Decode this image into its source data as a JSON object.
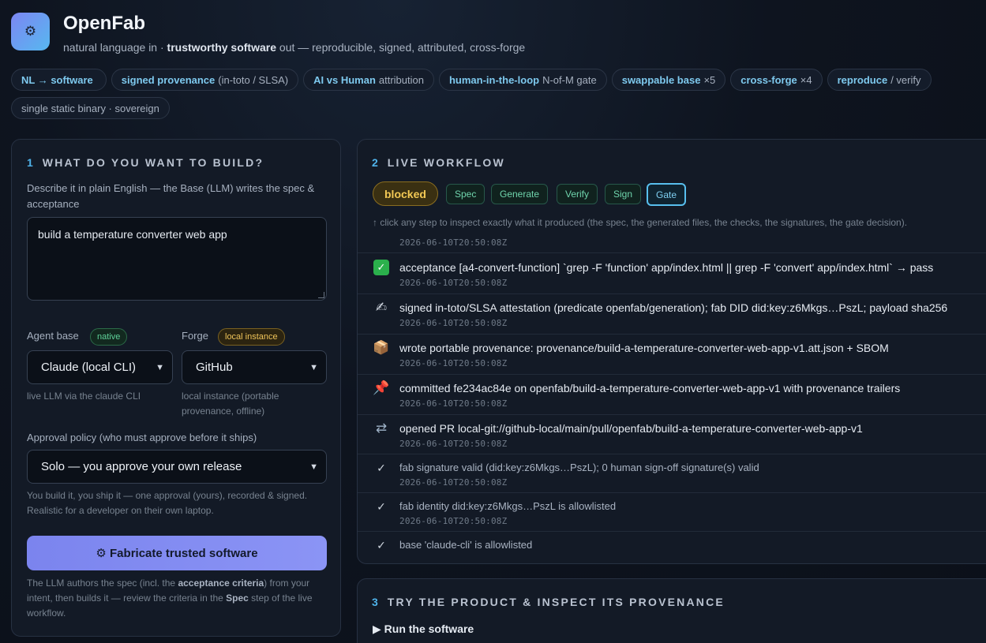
{
  "app": {
    "logo_icon": "gear-icon",
    "title": "OpenFab",
    "tagline_pre": "natural language in · ",
    "tagline_bold": "trustworthy software",
    "tagline_post": " out — reproducible, signed, attributed, cross-forge"
  },
  "features": [
    {
      "strong": "NL → software",
      "rest": ""
    },
    {
      "strong": "signed provenance",
      "rest": "(in-toto / SLSA)"
    },
    {
      "strong": "AI vs Human",
      "rest": "attribution"
    },
    {
      "strong": "human-in-the-loop",
      "rest": "N-of-M gate"
    },
    {
      "strong": "swappable base",
      "rest": "×5"
    },
    {
      "strong": "cross-forge",
      "rest": "×4"
    },
    {
      "strong": "reproduce",
      "rest": "/ verify"
    },
    {
      "strong": "",
      "rest": "single static binary · sovereign"
    }
  ],
  "build": {
    "num": "1",
    "title": "WHAT DO YOU WANT TO BUILD?",
    "describe_label": "Describe it in plain English — the Base (LLM) writes the spec & acceptance",
    "intent_value": "build a temperature converter web app",
    "agent_label": "Agent base",
    "agent_tag": "native",
    "agent_value": "Claude (local CLI)",
    "agent_hint": "live LLM via the claude CLI",
    "forge_label": "Forge",
    "forge_tag": "local instance",
    "forge_value": "GitHub",
    "forge_hint": "local instance (portable provenance, offline)",
    "policy_label": "Approval policy (who must approve before it ships)",
    "policy_value": "Solo — you approve your own release",
    "policy_hint": "You build it, you ship it — one approval (yours), recorded & signed. Realistic for a developer on their own laptop.",
    "cta_label": "⚙ Fabricate trusted software",
    "cta_hint_1": "The LLM authors the spec (incl. the ",
    "cta_hint_b1": "acceptance criteria",
    "cta_hint_2": ") from your intent, then builds it — review the criteria in the ",
    "cta_hint_b2": "Spec",
    "cta_hint_3": " step of the live workflow."
  },
  "workflow": {
    "num": "2",
    "title": "LIVE WORKFLOW",
    "status": "blocked",
    "status_color": "#f3c955",
    "steps": [
      "Spec",
      "Generate",
      "Verify",
      "Sign",
      "Gate"
    ],
    "active_step": "Gate",
    "hint": "↑ click any step to inspect exactly what it produced (the spec, the generated files, the checks, the signatures, the gate decision).",
    "events": [
      {
        "icon": "",
        "icon_name": "",
        "msg": "",
        "ts": "2026-06-10T20:50:08Z",
        "minor": false
      },
      {
        "icon": "✓",
        "icon_name": "check-box-icon",
        "msg": "acceptance [a4-convert-function] `grep -F 'function' app/index.html || grep -F 'convert' app/index.html` → pass",
        "ts": "2026-06-10T20:50:08Z",
        "minor": false
      },
      {
        "icon": "✍",
        "icon_name": "signing-pen-icon",
        "msg": "signed in-toto/SLSA attestation (predicate openfab/generation); fab DID did:key:z6Mkgs…PszL; payload sha256",
        "ts": "2026-06-10T20:50:08Z",
        "minor": false
      },
      {
        "icon": "📦",
        "icon_name": "package-icon",
        "msg": "wrote portable provenance: provenance/build-a-temperature-converter-web-app-v1.att.json + SBOM",
        "ts": "2026-06-10T20:50:08Z",
        "minor": false
      },
      {
        "icon": "📌",
        "icon_name": "pushpin-icon",
        "msg": "committed fe234ac84e on openfab/build-a-temperature-converter-web-app-v1 with provenance trailers",
        "ts": "2026-06-10T20:50:08Z",
        "minor": false
      },
      {
        "icon": "⇄",
        "icon_name": "merge-arrows-icon",
        "msg": "opened PR local-git://github-local/main/pull/openfab/build-a-temperature-converter-web-app-v1",
        "ts": "2026-06-10T20:50:08Z",
        "minor": false
      },
      {
        "icon": "✓",
        "icon_name": "checkmark-icon",
        "msg": "fab signature valid (did:key:z6Mkgs…PszL); 0 human sign-off signature(s) valid",
        "ts": "2026-06-10T20:50:08Z",
        "minor": true
      },
      {
        "icon": "✓",
        "icon_name": "checkmark-icon",
        "msg": "fab identity did:key:z6Mkgs…PszL is allowlisted",
        "ts": "2026-06-10T20:50:08Z",
        "minor": true
      },
      {
        "icon": "✓",
        "icon_name": "checkmark-icon",
        "msg": "base 'claude-cli' is allowlisted",
        "ts": "",
        "minor": true
      }
    ]
  },
  "product": {
    "num": "3",
    "title": "TRY THE PRODUCT & INSPECT ITS PROVENANCE",
    "run_label": "▶ Run the software"
  }
}
